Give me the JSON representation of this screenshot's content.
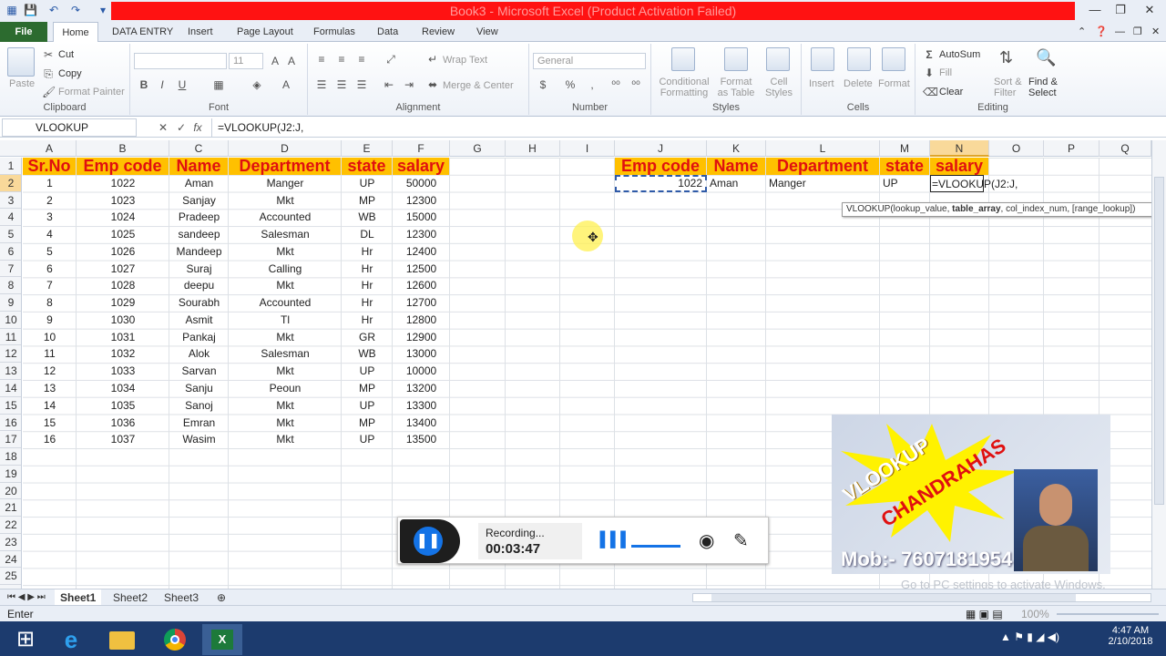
{
  "window": {
    "title": "Book3 - Microsoft Excel (Product Activation Failed)"
  },
  "ribbon_tabs": [
    "File",
    "Home",
    "DATA ENTRY",
    "Insert",
    "Page Layout",
    "Formulas",
    "Data",
    "Review",
    "View"
  ],
  "clipboard": {
    "paste": "Paste",
    "cut": "Cut",
    "copy": "Copy",
    "format_painter": "Format Painter",
    "label": "Clipboard"
  },
  "font": {
    "name": "",
    "size": "11",
    "label": "Font",
    "bold": "B",
    "italic": "I",
    "underline": "U"
  },
  "alignment": {
    "wrap": "Wrap Text",
    "merge": "Merge & Center",
    "label": "Alignment"
  },
  "number": {
    "format": "General",
    "label": "Number",
    "currency": "$",
    "percent": "%",
    "comma": ","
  },
  "styles": {
    "conditional": [
      "Conditional",
      "Formatting"
    ],
    "format_table": [
      "Format",
      "as Table"
    ],
    "cell_styles": [
      "Cell",
      "Styles"
    ],
    "label": "Styles"
  },
  "cells": {
    "insert": "Insert",
    "delete": "Delete",
    "format": "Format",
    "label": "Cells"
  },
  "editing": {
    "autosum": "AutoSum",
    "fill": "Fill",
    "clear": "Clear",
    "sort": [
      "Sort &",
      "Filter"
    ],
    "find": [
      "Find &",
      "Select"
    ],
    "label": "Editing"
  },
  "formula_bar": {
    "name_box": "VLOOKUP",
    "fx": "fx",
    "formula": "=VLOOKUP(J2:J,"
  },
  "columns": [
    "A",
    "B",
    "C",
    "D",
    "E",
    "F",
    "G",
    "H",
    "I",
    "J",
    "K",
    "L",
    "M",
    "N",
    "O",
    "P",
    "Q"
  ],
  "rows": [
    "1",
    "2",
    "3",
    "4",
    "5",
    "6",
    "7",
    "8",
    "9",
    "10",
    "11",
    "12",
    "13",
    "14",
    "15",
    "16",
    "17",
    "18",
    "19",
    "20",
    "21",
    "22",
    "23",
    "24",
    "25"
  ],
  "table_headers": [
    "Sr.No",
    "Emp code",
    "Name",
    "Department",
    "state",
    "salary"
  ],
  "table_rows": [
    [
      "1",
      "1022",
      "Aman",
      "Manger",
      "UP",
      "50000"
    ],
    [
      "2",
      "1023",
      "Sanjay",
      "Mkt",
      "MP",
      "12300"
    ],
    [
      "3",
      "1024",
      "Pradeep",
      "Accounted",
      "WB",
      "15000"
    ],
    [
      "4",
      "1025",
      "sandeep",
      "Salesman",
      "DL",
      "12300"
    ],
    [
      "5",
      "1026",
      "Mandeep",
      "Mkt",
      "Hr",
      "12400"
    ],
    [
      "6",
      "1027",
      "Suraj",
      "Calling",
      "Hr",
      "12500"
    ],
    [
      "7",
      "1028",
      "deepu",
      "Mkt",
      "Hr",
      "12600"
    ],
    [
      "8",
      "1029",
      "Sourabh",
      "Accounted",
      "Hr",
      "12700"
    ],
    [
      "9",
      "1030",
      "Asmit",
      "Tl",
      "Hr",
      "12800"
    ],
    [
      "10",
      "1031",
      "Pankaj",
      "Mkt",
      "GR",
      "12900"
    ],
    [
      "11",
      "1032",
      "Alok",
      "Salesman",
      "WB",
      "13000"
    ],
    [
      "12",
      "1033",
      "Sarvan",
      "Mkt",
      "UP",
      "10000"
    ],
    [
      "13",
      "1034",
      "Sanju",
      "Peoun",
      "MP",
      "13200"
    ],
    [
      "14",
      "1035",
      "Sanoj",
      "Mkt",
      "UP",
      "13300"
    ],
    [
      "15",
      "1036",
      "Emran",
      "Mkt",
      "MP",
      "13400"
    ],
    [
      "16",
      "1037",
      "Wasim",
      "Mkt",
      "UP",
      "13500"
    ]
  ],
  "lookup_headers": [
    "Emp code",
    "Name",
    "Department",
    "state",
    "salary"
  ],
  "lookup_row": [
    "1022",
    "Aman",
    "Manger",
    "UP",
    "=VLOOKUP(J2:J,"
  ],
  "tooltip": {
    "pre": "VLOOKUP(lookup_value, ",
    "bold": "table_array",
    "post": ", col_index_num, [range_lookup])"
  },
  "sheet_tabs": [
    "Sheet1",
    "Sheet2",
    "Sheet3"
  ],
  "status": {
    "mode": "Enter",
    "zoom": "100%"
  },
  "recording": {
    "label": "Recording...",
    "time": "00:03:47"
  },
  "promo": {
    "burst": [
      "VLOOKUP",
      "CHANDRAHAS"
    ],
    "mobile": "Mob:- 7607181954",
    "watermark": "Go to PC settings to activate Windows."
  },
  "taskbar": {
    "time": "4:47 AM",
    "date": "2/10/2018"
  },
  "colors": {
    "file_tab": "#2c6b2f",
    "header_fill": "#ffc000",
    "header_text": "#e01010",
    "title_red": "#ff1212",
    "taskbar": "#1c3b6e"
  }
}
